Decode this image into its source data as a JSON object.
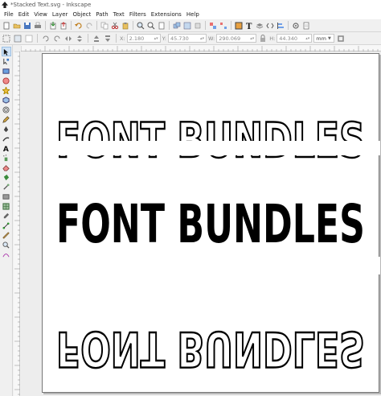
{
  "window": {
    "title": "*Stacked Text.svg - Inkscape"
  },
  "menubar": {
    "items": [
      "File",
      "Edit",
      "View",
      "Layer",
      "Object",
      "Path",
      "Text",
      "Filters",
      "Extensions",
      "Help"
    ]
  },
  "controls": {
    "x_label": "X:",
    "x_value": "2.180",
    "y_label": "Y:",
    "y_value": "45.730",
    "w_label": "W:",
    "w_value": "290.069",
    "h_label": "H:",
    "h_value": "44.340",
    "unit": "mm"
  },
  "canvas": {
    "text_outline_top": "FONT BUNDLES",
    "text_filled_middle": "FONT BUNDLES",
    "text_outline_bottom": "FONT BUNDLES"
  },
  "colors": {
    "ink": "#000000",
    "page": "#ffffff",
    "canvas_bg": "#ededed",
    "chrome": "#f0f0f0"
  }
}
